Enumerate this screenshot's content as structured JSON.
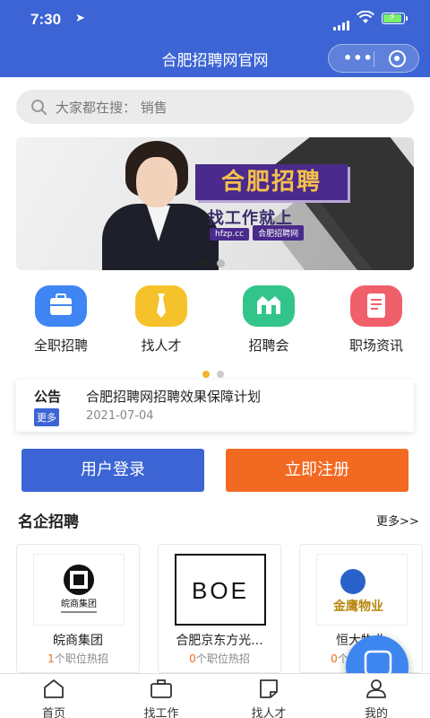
{
  "status": {
    "time": "7:30"
  },
  "nav": {
    "title": "合肥招聘网官网"
  },
  "search": {
    "placeholder": "大家都在搜：  销售"
  },
  "banner": {
    "title": "合肥招聘",
    "subtitle": "找工作就上",
    "site": "hfzp.cc",
    "brand": "合肥招聘网"
  },
  "menu": [
    {
      "label": "全职招聘",
      "icon": "briefcase-icon",
      "color": "#3f86f4"
    },
    {
      "label": "找人才",
      "icon": "tie-icon",
      "color": "#f6c22b"
    },
    {
      "label": "招聘会",
      "icon": "fair-icon",
      "color": "#33c48b"
    },
    {
      "label": "职场资讯",
      "icon": "news-icon",
      "color": "#f0606a"
    }
  ],
  "notice": {
    "tag": "公告",
    "more": "更多",
    "title": "合肥招聘网招聘效果保障计划",
    "date": "2021-07-04"
  },
  "actions": {
    "login": "用户登录",
    "register": "立即注册"
  },
  "section": {
    "title": "名企招聘",
    "more": "更多>>"
  },
  "companies": [
    {
      "name": "皖商集团",
      "count": "1",
      "suffix": "个职位热招",
      "logo_text": "皖商集团"
    },
    {
      "name": "合肥京东方光...",
      "count": "0",
      "suffix": "个职位热招",
      "logo_text": "BOE"
    },
    {
      "name": "恒大物业",
      "count": "0",
      "suffix": "个职位热招",
      "logo_text": "金鹰物业"
    }
  ],
  "tabs": [
    {
      "label": "首页",
      "icon": "home-icon"
    },
    {
      "label": "找工作",
      "icon": "briefcase-icon"
    },
    {
      "label": "找人才",
      "icon": "note-icon"
    },
    {
      "label": "我的",
      "icon": "user-icon"
    }
  ],
  "colors": {
    "primary": "#3c64d4",
    "accent": "#f26a22",
    "float": "#3d86ef"
  }
}
